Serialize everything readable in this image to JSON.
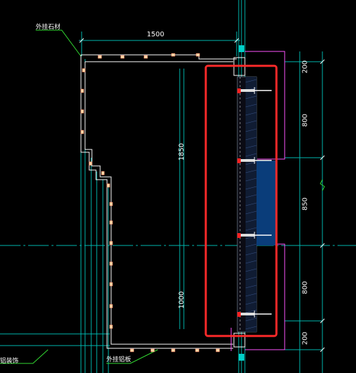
{
  "drawing": {
    "labels": {
      "stone_top": "外挂石材",
      "stone_bottom": "外挂铝板",
      "corner": "铝装饰"
    },
    "dimensions": {
      "width_top": "1500",
      "height_left_upper": "1850",
      "height_left_lower": "1000",
      "right_1": "200",
      "right_2": "800",
      "right_3": "850",
      "right_4": "800",
      "right_5": "200"
    },
    "colors": {
      "background": "#000000",
      "highlight_box": "#ff2a2a",
      "panel_fill": "#0a3d7a",
      "grid_line": "#00d0c8",
      "section_line": "#ff55ff",
      "outline": "#ffffff"
    }
  }
}
